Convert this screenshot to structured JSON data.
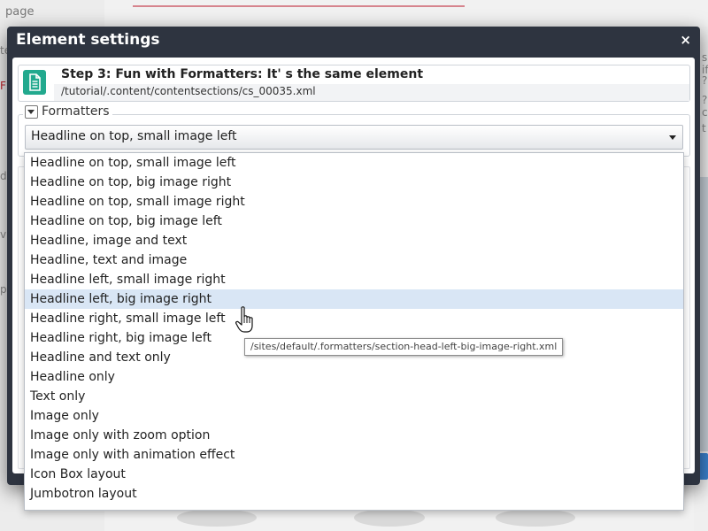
{
  "background": {
    "left_label": "page",
    "left_fragments": [
      "te",
      "F",
      "d",
      "v",
      "p"
    ],
    "right_fragments": [
      "s",
      "ifi",
      "?",
      "?c",
      "t"
    ]
  },
  "dialog": {
    "title": "Element settings",
    "close_glyph": "×"
  },
  "element": {
    "icon": "document-icon",
    "title": "Step 3: Fun with Formatters: It' s  the same element",
    "path": "/tutorial/.content/contentsections/cs_00035.xml"
  },
  "formatters": {
    "legend": "Formatters",
    "selected": "Headline on top, small image left",
    "options": [
      "Headline on top, small image left",
      "Headline on top, big image right",
      "Headline on top, small image right",
      "Headline on top, big image left",
      "Headline, image and text",
      "Headline, text and image",
      "Headline left, small image right",
      "Headline left, big image right",
      "Headline right, small image left",
      "Headline right, big image left",
      "Headline and text only",
      "Headline only",
      "Text only",
      "Image only",
      "Image only with zoom option",
      "Image only with animation effect",
      "Icon Box layout",
      "Jumbotron layout"
    ],
    "hovered_index": 7,
    "tooltip": "/sites/default/.formatters/section-head-left-big-image-right.xml"
  },
  "colors": {
    "dialog_header": "#2e3440",
    "doc_icon": "#22a98e",
    "hover_row": "#d9e6f5"
  }
}
